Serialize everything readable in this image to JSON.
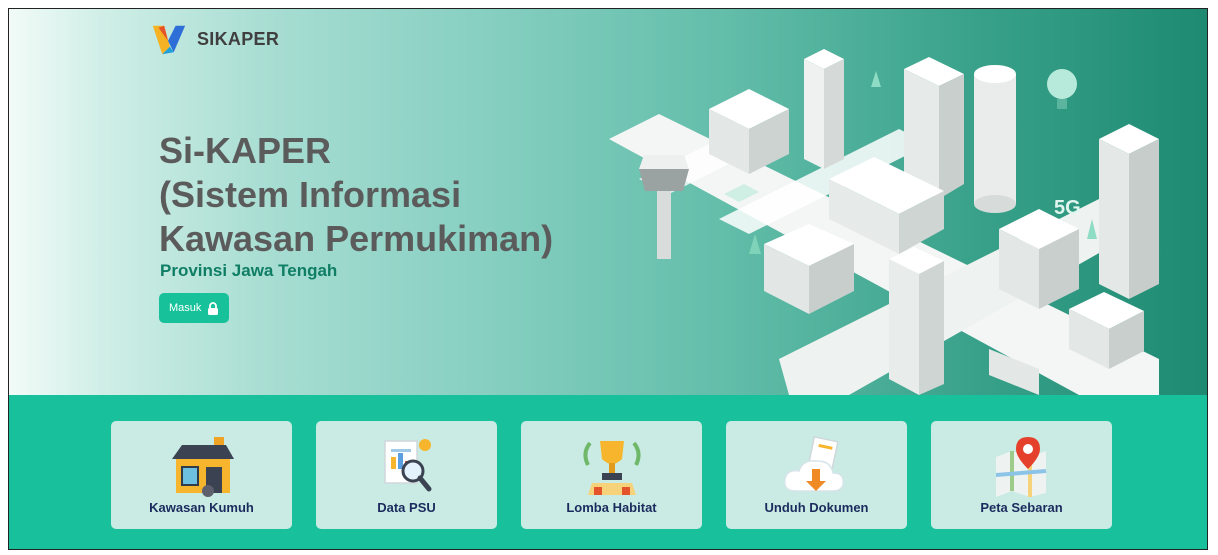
{
  "brand": {
    "name": "SIKAPER"
  },
  "hero": {
    "title_lines": [
      "Si-KAPER",
      "(Sistem Informasi",
      "Kawasan Permukiman)"
    ],
    "subtitle": "Provinsi Jawa Tengah",
    "login_label": "Masuk",
    "login_icon": "lock-icon",
    "street_sign": "5G"
  },
  "menu": [
    {
      "label": "Kawasan Kumuh",
      "icon": "house-icon"
    },
    {
      "label": "Data PSU",
      "icon": "document-search-icon"
    },
    {
      "label": "Lomba Habitat",
      "icon": "trophy-icon"
    },
    {
      "label": "Unduh Dokumen",
      "icon": "cloud-download-icon"
    },
    {
      "label": "Peta Sebaran",
      "icon": "map-pin-icon"
    }
  ],
  "colors": {
    "accent": "#17c29a",
    "footer_bg": "#18c19c",
    "card_bg": "#c9ebe3",
    "subtitle": "#0f7e64",
    "card_label": "#1c2b5e"
  }
}
